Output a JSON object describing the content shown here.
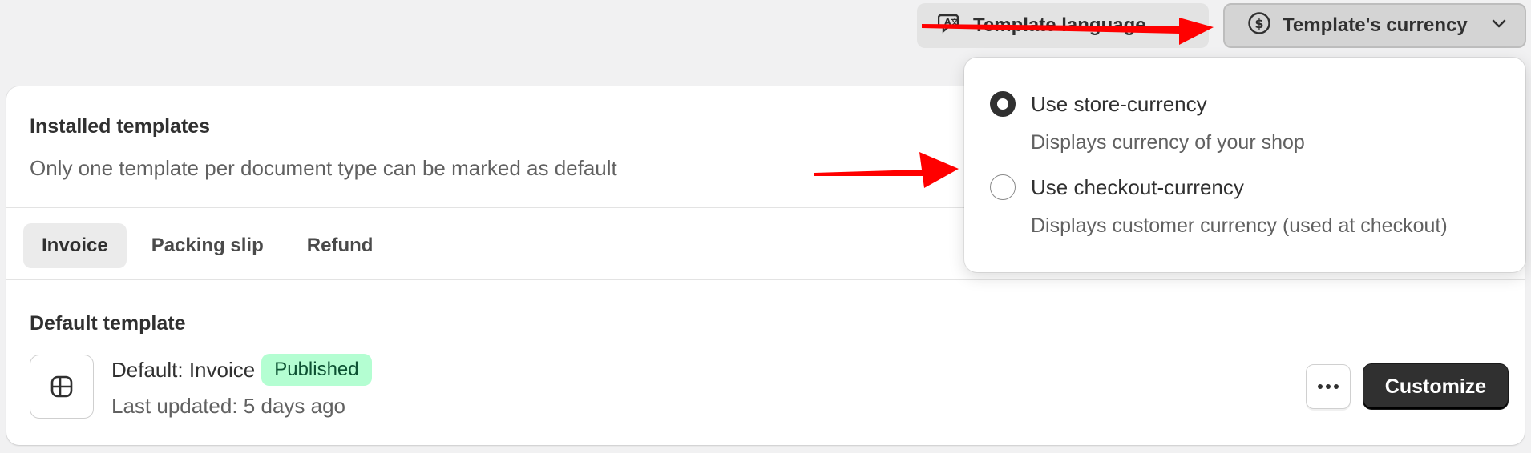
{
  "top_bar": {
    "language_button_label": "Template language",
    "currency_button_label": "Template's currency"
  },
  "card": {
    "title": "Installed templates",
    "subtitle": "Only one template per document type can be marked as default",
    "tabs": [
      {
        "label": "Invoice",
        "active": true
      },
      {
        "label": "Packing slip",
        "active": false
      },
      {
        "label": "Refund",
        "active": false
      }
    ],
    "section_title": "Default template",
    "template": {
      "name": "Default: Invoice",
      "status": "Published",
      "last_updated": "Last updated: 5 days ago"
    },
    "customize_label": "Customize"
  },
  "currency_menu": {
    "options": [
      {
        "label": "Use store-currency",
        "description": "Displays currency of your shop",
        "selected": true
      },
      {
        "label": "Use checkout-currency",
        "description": "Displays customer currency (used at checkout)",
        "selected": false
      }
    ]
  },
  "colors": {
    "accent_dark": "#303030",
    "badge_bg": "#b4fed2",
    "badge_text": "#0c5132",
    "annotation_red": "#ff0000"
  },
  "icons": [
    "translate-icon",
    "dollar-circle-icon",
    "chevron-down-icon",
    "template-layout-icon",
    "more-horizontal-icon",
    "radio-checked-icon",
    "radio-unchecked-icon"
  ]
}
